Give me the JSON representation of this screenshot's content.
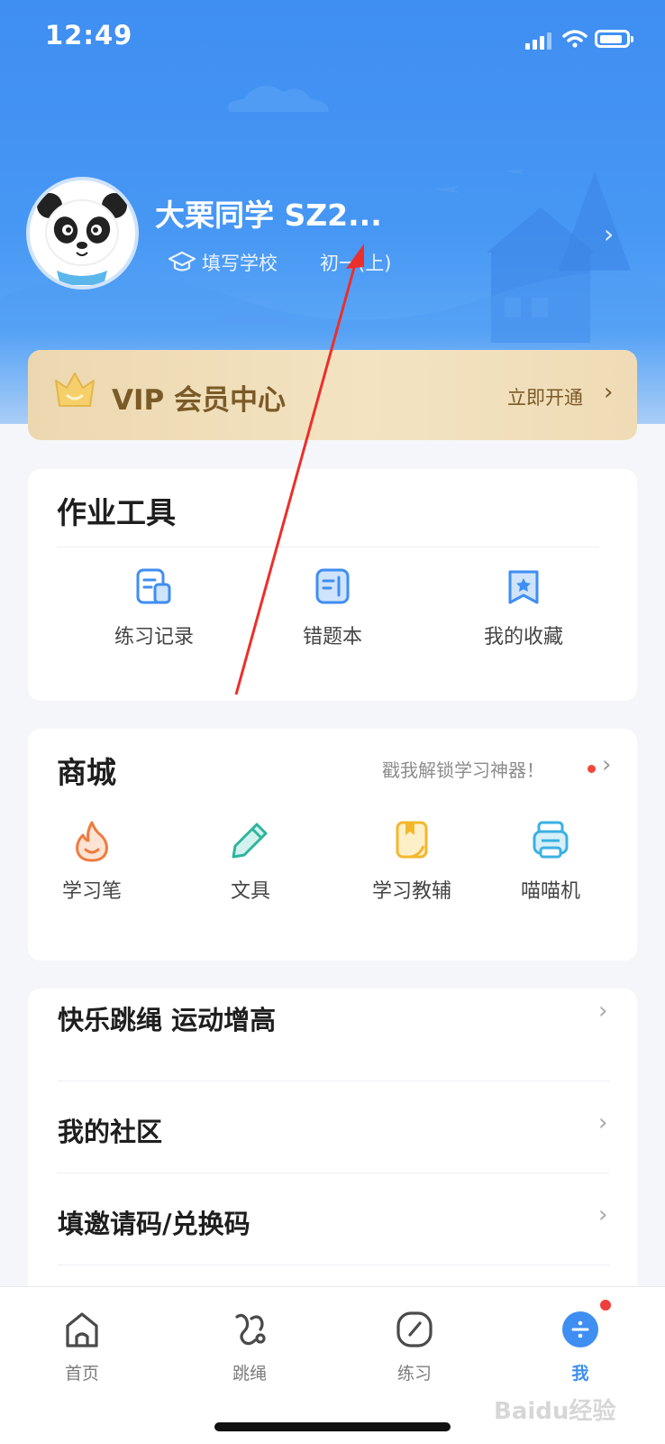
{
  "status_bar": {
    "time": "12:49"
  },
  "profile": {
    "name": "大栗同学 SZ2...",
    "school": "填写学校",
    "grade": "初一(上)"
  },
  "vip": {
    "title": "VIP 会员中心",
    "action": "立即开通"
  },
  "tools": {
    "title": "作业工具",
    "items": [
      {
        "label": "练习记录",
        "icon": "practice-record-icon"
      },
      {
        "label": "错题本",
        "icon": "wrong-questions-icon"
      },
      {
        "label": "我的收藏",
        "icon": "favorites-icon"
      }
    ]
  },
  "shop": {
    "title": "商城",
    "promo": "戳我解锁学习神器！",
    "items": [
      {
        "label": "学习笔",
        "icon": "flame-pen-icon"
      },
      {
        "label": "文具",
        "icon": "pencil-icon"
      },
      {
        "label": "学习教辅",
        "icon": "book-icon"
      },
      {
        "label": "喵喵机",
        "icon": "printer-icon"
      }
    ]
  },
  "menu": [
    {
      "label": "快乐跳绳  运动增高"
    },
    {
      "label": "我的社区"
    },
    {
      "label": "填邀请码/兑换码"
    }
  ],
  "nav": [
    {
      "label": "首页",
      "icon": "home-icon"
    },
    {
      "label": "跳绳",
      "icon": "jump-rope-icon"
    },
    {
      "label": "练习",
      "icon": "compass-icon"
    },
    {
      "label": "我",
      "icon": "me-icon"
    }
  ],
  "watermark": "Baidu经验",
  "colors": {
    "primary": "#3f8ef2",
    "vip_text": "#7a5a27",
    "badge": "#f1473c"
  }
}
